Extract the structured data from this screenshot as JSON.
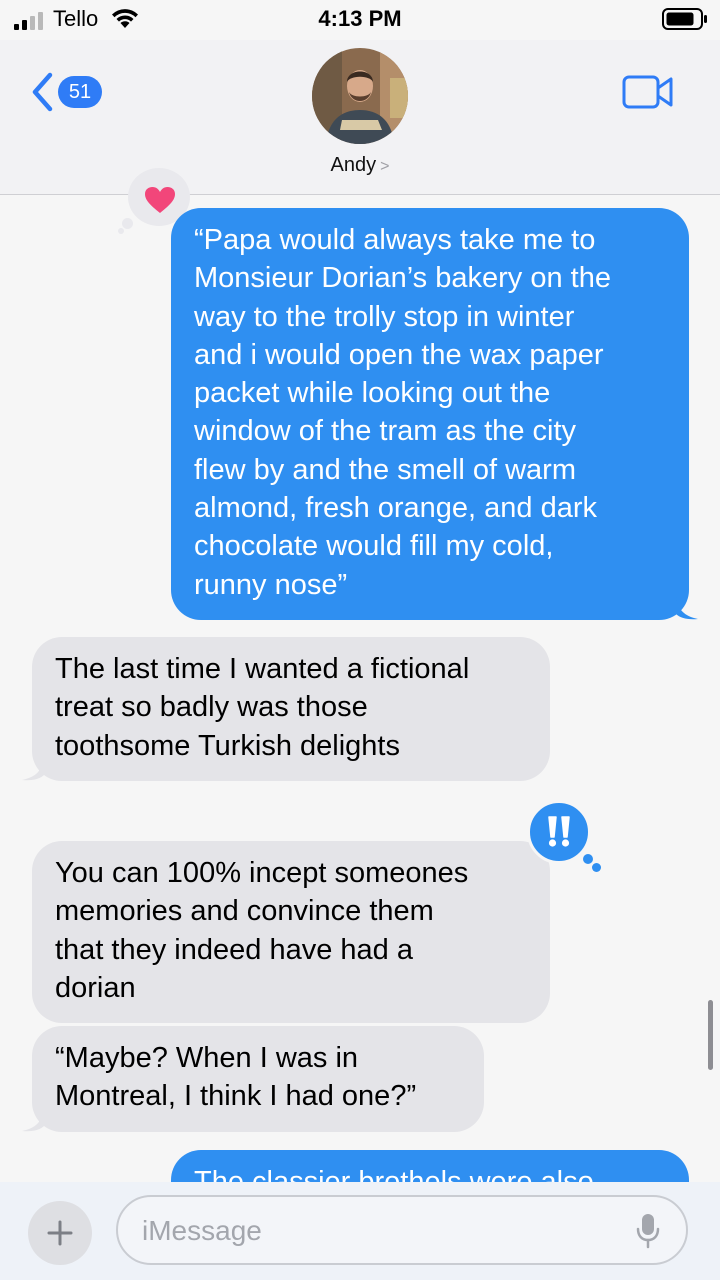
{
  "status": {
    "carrier": "Tello",
    "time": "4:13 PM",
    "signal_bars": 2,
    "icons": [
      "signal-icon",
      "wifi-icon",
      "battery-icon"
    ]
  },
  "header": {
    "back_count": "51",
    "contact_name": "Andy",
    "icons": [
      "chevron-left-icon",
      "chevron-right-icon",
      "video-camera-icon"
    ]
  },
  "messages": [
    {
      "side": "sent",
      "text": "“Papa would always take me to\nMonsieur Dorian’s bakery on the\nway to the trolly stop in winter\nand i would open the wax paper\npacket while looking out the\nwindow of the tram as the city\nflew by and the smell of warm\nalmond, fresh orange, and dark\nchocolate would fill my cold,\nrunny nose”",
      "tapback": "heart-icon"
    },
    {
      "side": "received",
      "text": "The last time I wanted a fictional\ntreat so badly was those\ntoothsome Turkish delights"
    },
    {
      "side": "received",
      "text": "You can 100% incept someones\nmemories and convince them\nthat they indeed have had a\ndorian",
      "tapback": "exclamation-icon"
    },
    {
      "side": "received",
      "text": "“Maybe? When I was in\nMontreal, I think I had one?”"
    },
    {
      "side": "sent",
      "text": "The classier brothels were also"
    }
  ],
  "compose": {
    "placeholder": "iMessage",
    "value": "",
    "icons": [
      "plus-icon",
      "microphone-icon"
    ]
  },
  "colors": {
    "sent_bubble": "#2f8ff1",
    "received_bubble": "#e4e4e8",
    "accent": "#2f7cf6"
  }
}
